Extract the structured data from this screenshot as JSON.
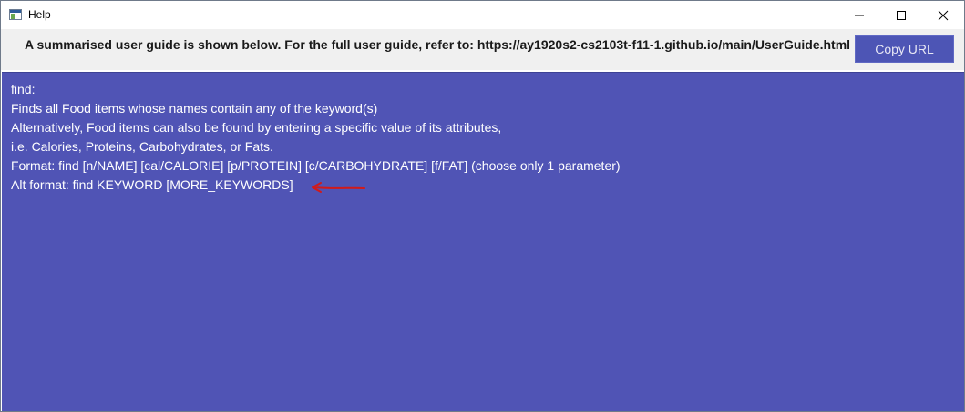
{
  "window": {
    "title": "Help",
    "icon": "app-window-icon",
    "controls": [
      "minimize-icon",
      "maximize-icon",
      "close-icon"
    ]
  },
  "header": {
    "guide_text": "A summarised user guide is shown below. For the full user guide, refer to: https://ay1920s2-cs2103t-f11-1.github.io/main/UserGuide.html",
    "copy_button_label": "Copy URL"
  },
  "content": {
    "lines": [
      "find:",
      "Finds all Food items whose names contain any of the keyword(s)",
      "Alternatively, Food items can also be found by entering a specific value of its attributes,",
      "i.e. Calories, Proteins, Carbohydrates, or Fats.",
      "Format: find [n/NAME] [cal/CALORIE] [p/PROTEIN] [c/CARBOHYDRATE] [f/FAT] (choose only 1 parameter)",
      "Alt format: find KEYWORD [MORE_KEYWORDS]"
    ],
    "annotation": "red-arrow-icon"
  },
  "colors": {
    "content_bg": "#5054b5",
    "button_bg": "#4d55b5",
    "header_bg": "#f0f0f0",
    "arrow": "#d11a1a"
  }
}
